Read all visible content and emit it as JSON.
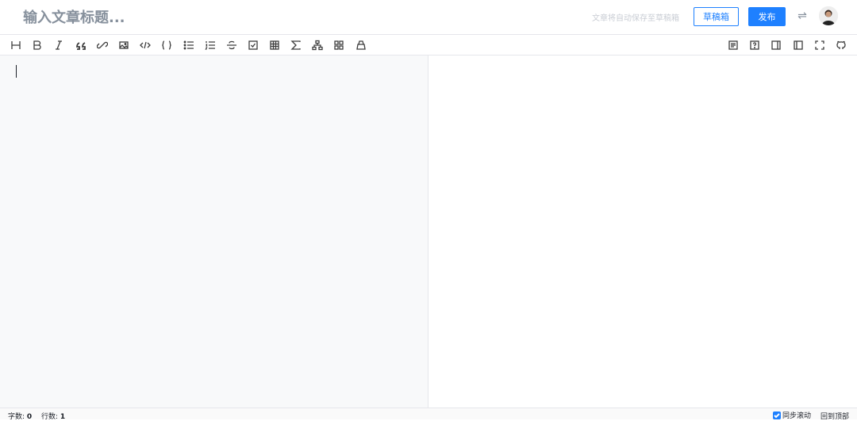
{
  "header": {
    "title_placeholder": "输入文章标题...",
    "autosave_text": "文章将自动保存至草稿箱",
    "draft_button": "草稿箱",
    "publish_button": "发布",
    "switch_icon": "⇌"
  },
  "toolbar": {
    "left_tools": [
      "heading-icon",
      "bold-icon",
      "italic-icon",
      "quote-icon",
      "link-icon",
      "image-icon",
      "inline-code-icon",
      "code-block-icon",
      "unordered-list-icon",
      "ordered-list-icon",
      "strikethrough-icon",
      "task-list-icon",
      "table-icon",
      "formula-icon",
      "diagram-icon",
      "theme-icon",
      "clear-icon"
    ],
    "right_tools": [
      "toc-icon",
      "help-icon",
      "preview-only-icon",
      "write-only-icon",
      "fullscreen-icon",
      "github-icon"
    ]
  },
  "status": {
    "word_count_label": "字数:",
    "word_count_value": "0",
    "line_count_label": "行数:",
    "line_count_value": "1",
    "sync_scroll_label": "同步滚动",
    "back_to_top": "回到顶部"
  },
  "colors": {
    "accent": "#1e80ff",
    "editor_bg": "#f8f9fa",
    "border": "#e5e6eb"
  }
}
